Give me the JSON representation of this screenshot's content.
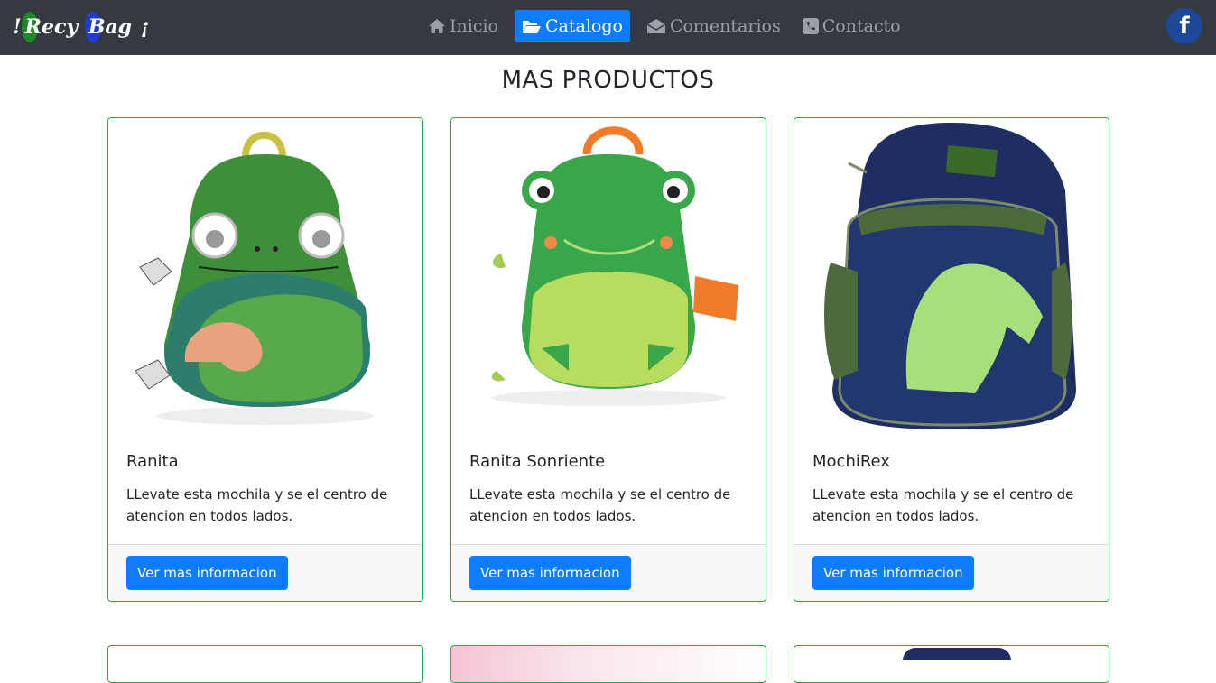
{
  "brand": {
    "open": "!",
    "word1": "Recy",
    "word2": "Bag",
    "close": "¡"
  },
  "nav": [
    {
      "label": "Inicio",
      "icon": "home-icon",
      "active": false
    },
    {
      "label": "Catalogo",
      "icon": "folder-open-icon",
      "active": true
    },
    {
      "label": "Comentarios",
      "icon": "envelope-open-icon",
      "active": false
    },
    {
      "label": "Contacto",
      "icon": "phone-square-icon",
      "active": false
    }
  ],
  "social": {
    "facebook_letter": "f",
    "icon": "facebook-icon"
  },
  "page_title": "MAS PRODUCTOS",
  "products": [
    {
      "name": "Ranita",
      "description": "LLevate esta mochila y se el centro de atencion en todos lados.",
      "button": "Ver mas informacion",
      "image": "chameleon-backpack-image"
    },
    {
      "name": "Ranita Sonriente",
      "description": "LLevate esta mochila y se el centro de atencion en todos lados.",
      "button": "Ver mas informacion",
      "image": "frog-backpack-image"
    },
    {
      "name": "MochiRex",
      "description": "LLevate esta mochila y se el centro de atencion en todos lados.",
      "button": "Ver mas informacion",
      "image": "dino-world-backpack-image"
    }
  ],
  "colors": {
    "navbar": "#343a40",
    "primary": "#0d7dfd",
    "card_border": "#28a745",
    "facebook": "#1d4797"
  }
}
